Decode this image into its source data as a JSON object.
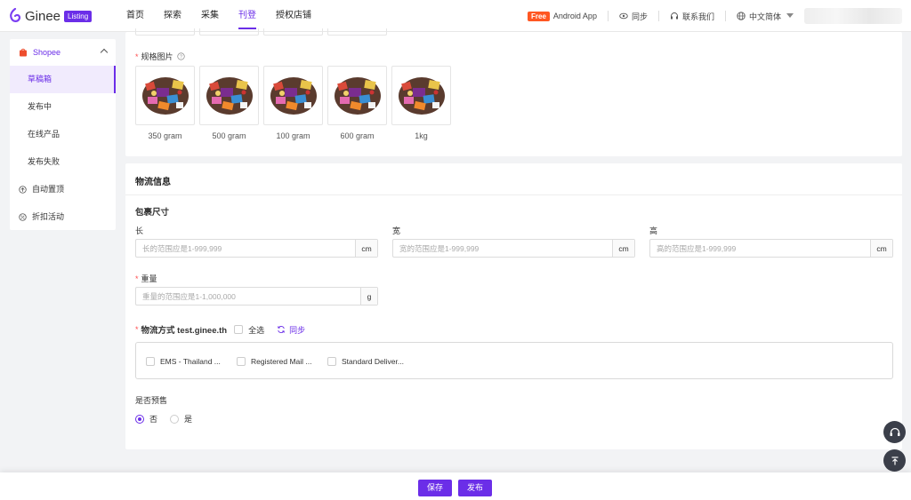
{
  "header": {
    "logo_text": "Ginee",
    "logo_badge": "Listing",
    "nav": [
      "首页",
      "探索",
      "采集",
      "刊登",
      "授权店铺"
    ],
    "free_badge": "Free",
    "android_app": "Android App",
    "sync": "同步",
    "contact": "联系我们",
    "language": "中文简体"
  },
  "sidebar": {
    "platform": "Shopee",
    "items": [
      "草稿箱",
      "发布中",
      "在线产品",
      "发布失败"
    ],
    "extra": [
      "自动置顶",
      "折扣活动"
    ]
  },
  "spec_images": {
    "label": "规格图片",
    "items": [
      "350 gram",
      "500 gram",
      "100 gram",
      "600 gram",
      "1kg"
    ]
  },
  "logistics": {
    "title": "物流信息",
    "package_size": "包裹尺寸",
    "length_label": "长",
    "width_label": "宽",
    "height_label": "高",
    "length_placeholder": "长的范围应是1-999,999",
    "width_placeholder": "宽的范围应是1-999,999",
    "height_placeholder": "高的范围应是1-999,999",
    "unit_cm": "cm",
    "weight_label": "重量",
    "weight_placeholder": "重量的范围应是1-1,000,000",
    "unit_g": "g",
    "shipping_label": "物流方式 test.ginee.th",
    "select_all": "全选",
    "sync": "同步",
    "shipping_options": [
      "EMS - Thailand ...",
      "Registered Mail ...",
      "Standard Deliver..."
    ],
    "preorder_label": "是否预售",
    "preorder_no": "否",
    "preorder_yes": "是"
  },
  "footer": {
    "save": "保存",
    "publish": "发布"
  },
  "colors": {
    "accent": "#6b2ee8",
    "free": "#ff5722"
  }
}
